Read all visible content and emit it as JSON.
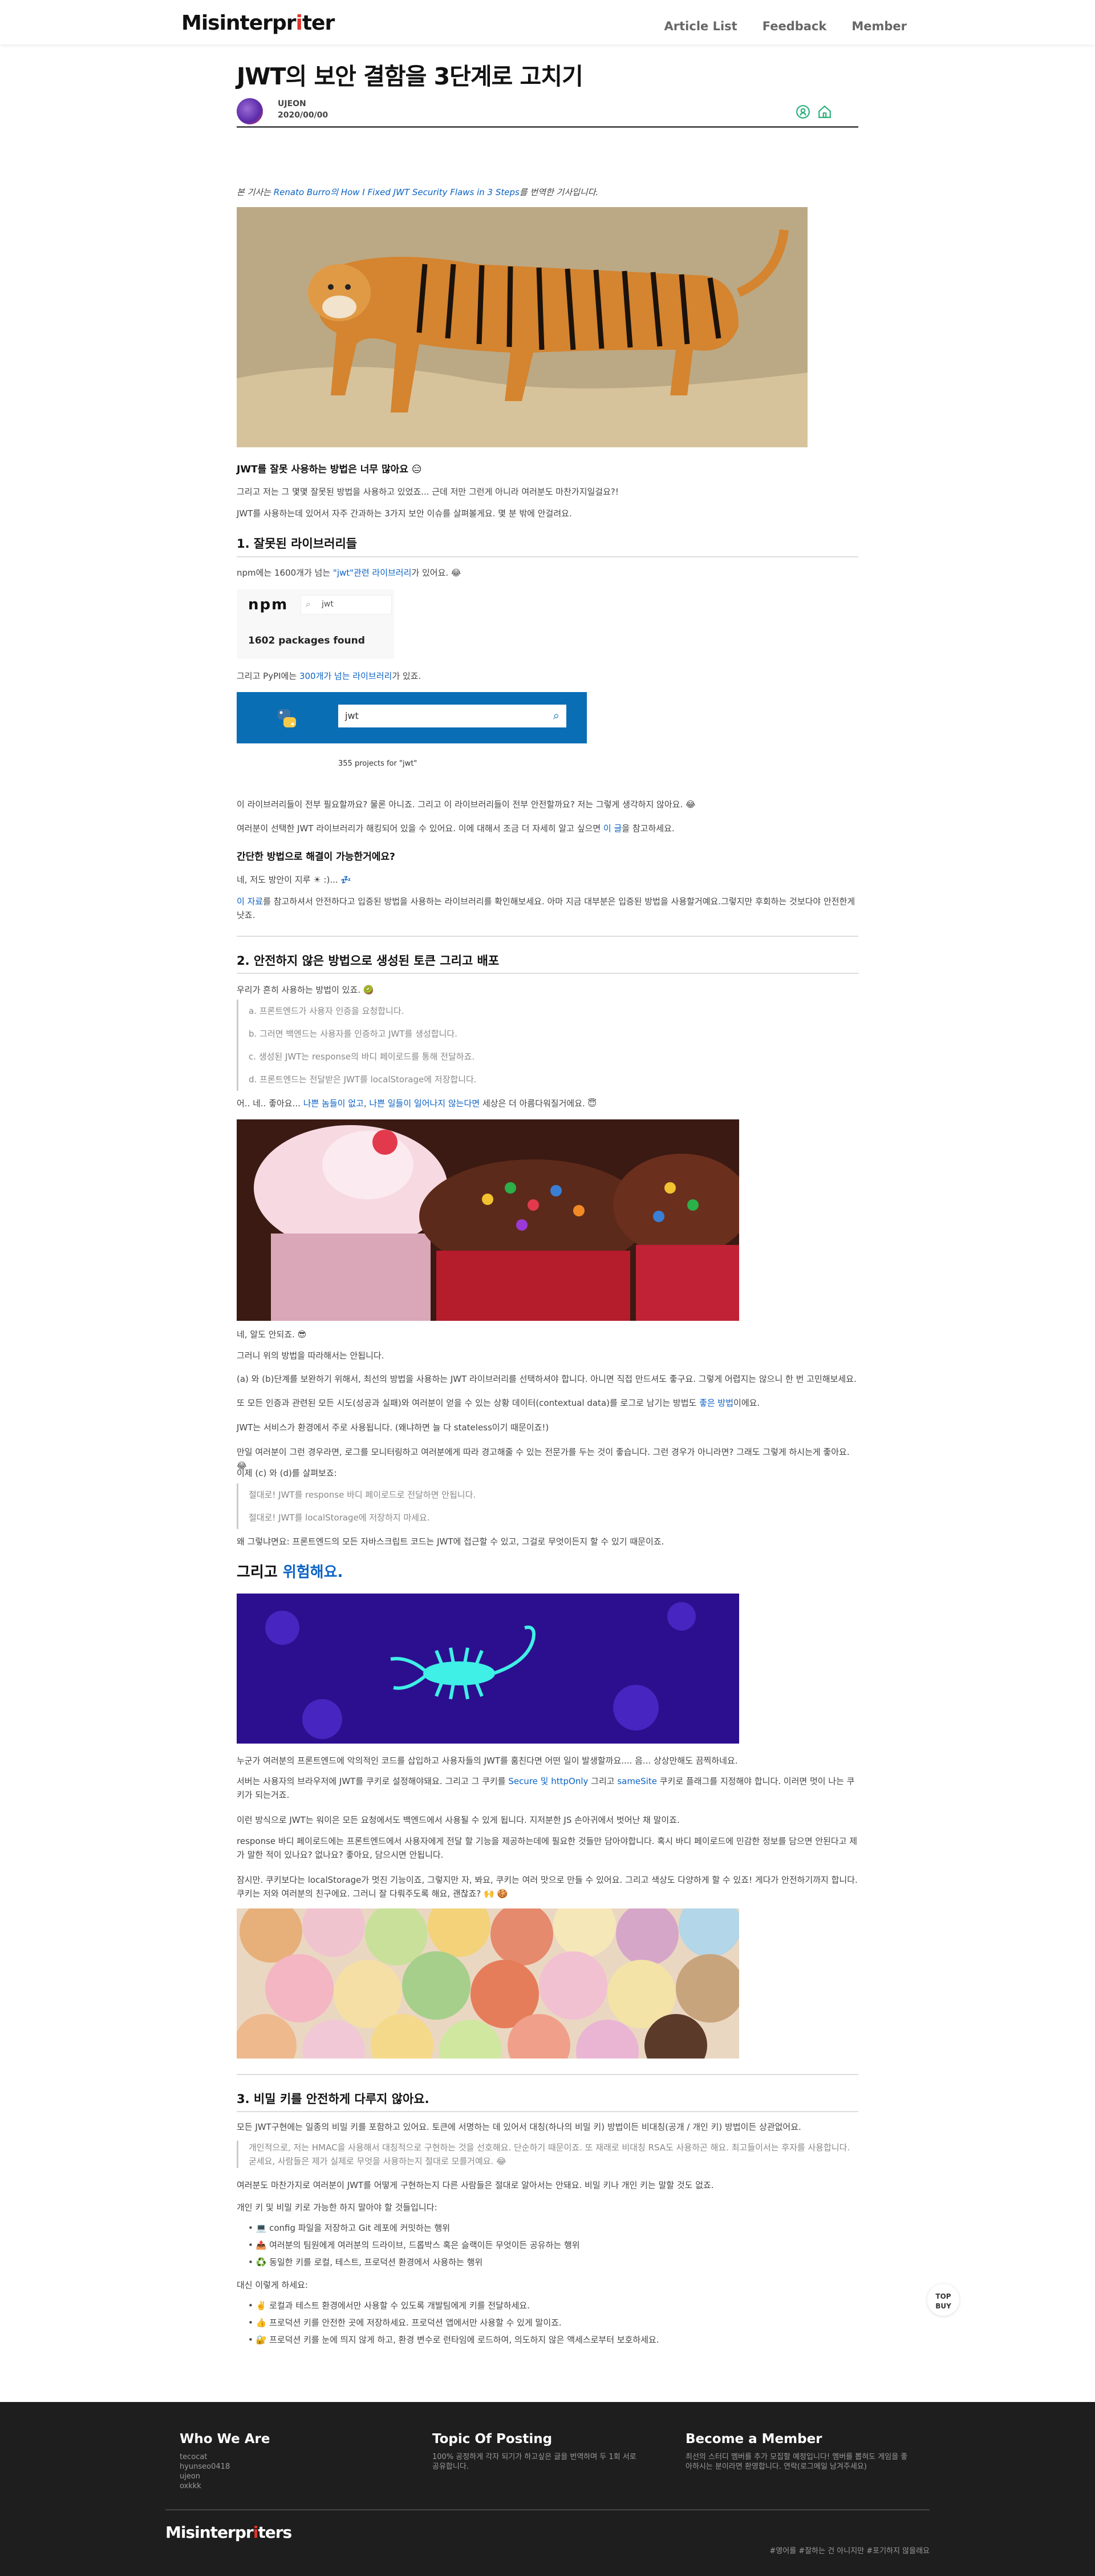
{
  "header": {
    "logo_main": "Misinterpr",
    "logo_accent": "i",
    "logo_end": "ter",
    "nav": [
      "Article List",
      "Feedback",
      "Member"
    ]
  },
  "post": {
    "title": "JWT의 보안 결함을 3단계로 고치기",
    "author": "UJEON",
    "date": "2020/00/00"
  },
  "intro": {
    "prefix": "본 기사는 ",
    "link": "Renato Burro의 How I Fixed JWT Security Flaws in 3 Steps",
    "suffix": "를 번역한 기사입니다."
  },
  "s0": {
    "heading": "JWT를 잘못 사용하는 방법은 너무 많아요 😑",
    "p1": "그리고 저는 그 몇몇 잘못된 방법을 사용하고 있었죠... 근데 저만 그런게 아니라 여러분도 마찬가지일걸요?!",
    "p2": "JWT를 사용하는데 있어서 자주 간과하는 3가지 보안 이슈를 살펴볼게요. 몇 분 밖에 안걸려요."
  },
  "s1": {
    "heading": "1. 잘못된 라이브러리들",
    "npm_prefix": "npm에는 1600개가 넘는 ",
    "npm_link": "\"jwt\"관련 라이브러리",
    "npm_suffix": "가 있어요. 😂",
    "npm_logo": "npm",
    "npm_search": "jwt",
    "npm_count": "1602 packages found",
    "pypi_prefix": "그리고 PyPI에는 ",
    "pypi_link": "300개가 넘는 라이브러리",
    "pypi_suffix": "가 있죠.",
    "pypi_search": "jwt",
    "pypi_count": "355 projects for \"jwt\"",
    "p1": "이 라이브러리들이 전부 필요할까요? 물론 아니죠. 그리고 이 라이브러리들이 전부 안전할까요? 저는 그렇게 생각하지 않아요. 😂",
    "p2_prefix": "여러분이 선택한 JWT 라이브러리가 해킹되어 있을 수 있어요. 이에 대해서 조금 더 자세히 알고 싶으면 ",
    "p2_link": "이 글",
    "p2_suffix": "을 참고하세요.",
    "sub": "간단한 방법으로 해결이 가능한거에요?",
    "p3": "네, 저도 방안이 지루 ☀ :)... 💤",
    "p4_link": "이 자료",
    "p4": "를 참고하셔서 안전하다고 입증된 방법을 사용하는 라이브러리를 확인해보세요. 아마 지금 대부분은 입증된 방법을 사용할거예요.그렇지만 후회하는 것보다야 안전한게 낫죠."
  },
  "s2": {
    "heading": "2. 안전하지 않은 방법으로 생성된 토큰 그리고 배포",
    "p0": "우리가 흔히 사용하는 방법이 있죠. 🥝",
    "list": [
      "a. 프론트엔드가 사용자 인증을 요청합니다.",
      "b. 그러면 백엔드는 사용자를 인증하고 JWT를 생성합니다.",
      "c. 생성된 JWT는 response의 바디 페이로드를 통해 전달하죠.",
      "d. 프론트엔드는 전달받은 JWT를 localStorage에 저장합니다."
    ],
    "p1_prefix": "어.. 네.. 좋아요... ",
    "p1_link1": "나쁜 놈들이 없고",
    "p1_mid": ", ",
    "p1_link2": "나쁜 일들이 일어나지 않는다면",
    "p1_suffix": " 세상은 더 아름다워질거에요. 😇",
    "p2": "네, 알도 안되죠. 😎",
    "p3": "그러니 위의 방법을 따라해서는 안됩니다.",
    "p4": "(a) 와 (b)단계를 보완하기 위해서, 최선의 방법을 사용하는 JWT 라이브러리를 선택하셔야 합니다. 아니면 직접 만드셔도 좋구요. 그렇게 어렵지는 않으니 한 번 고민해보세요.",
    "p5_prefix": "또 모든 인증과 관련된 모든 시도(성공과 실패)와 여러분이 얻을 수 있는 상황 데이터(contextual data)를 로그로 남기는 방법도 ",
    "p5_link": "좋은 방법",
    "p5_suffix": "이에요.",
    "p6": "JWT는 서비스가 환경에서 주로 사용됩니다. (왜냐하면 늘 다 stateless이기 때문이죠!)",
    "p7": "만일 여러분이 그런 경우라면, 로그를 모니터링하고 여러분에게 따라 경고해줄 수 있는 전문가를 두는 것이 좋습니다. 그런 경우가 아니라면? 그래도 그렇게 하시는게 좋아요. 😂",
    "p8": "이제 (c) 와 (d)를 살펴보죠:",
    "list2": [
      "절대로! JWT를 response 바디 페이로드로 전달하면 안됩니다.",
      "절대로! JWT를 localStorage에 저장하지 마세요."
    ],
    "p9": "왜 그렇냐면요: 프론트엔드의 모든 자바스크립트 코드는 JWT에 접근할 수 있고, 그걸로 무엇이든지 할 수 있기 때문이죠.",
    "big_prefix": "그리고 ",
    "big_link": "위험해요.",
    "p10": "누군가 여러분의 프론트엔드에 악의적인 코드를 삽입하고 사용자들의 JWT를 훔친다면 어떤 일이 발생할까요.... 음... 상상만해도 끔찍하네요.",
    "p11_prefix": "서버는 사용자의 브라우저에 JWT를 쿠키로 설정해야돼요. 그리고 그 쿠키를 ",
    "p11_link1": "Secure 및 httpOnly",
    "p11_mid": " 그리고 ",
    "p11_link2": "sameSite",
    "p11_suffix": " 쿠키로 플래그를 지정해야 합니다. 이러면 멋이 나는 쿠키가 되는거죠.",
    "p12": "이런 방식으로 JWT는 워이은 모든 요청에서도 백엔드에서 사용될 수 있게 됩니다. 지저분한 JS 손아귀에서 벗어난 채 말이죠.",
    "p13": "response 바디 페이로드에는 프론트엔드에서 사용자에게 전달 할 기능을 제공하는데에 필요한 것들만 담아야합니다. 혹시 바디 페이로드에 민감한 정보를 담으면 안된다고 제가 말한 적이 있나요? 없나요? 좋아요, 담으시면 안됩니다.",
    "p14": "잠시만. 쿠키보다는 localStorage가 멋진 기능이죠, 그렇지만 자, 봐요, 쿠키는 여러 맛으로 만들 수 있어요. 그리고 색상도 다양하게 할 수 있죠! 게다가 안전하기까지 합니다. 쿠키는 저와 여러분의 친구에요. 그러니 잘 다뤄주도록 해요, 괜찮죠? 🙌 🍪"
  },
  "s3": {
    "heading": "3. 비밀 키를 안전하게 다루지 않아요.",
    "p1": "모든 JWT구현에는 일종의 비밀 키를 포함하고 있어요. 토큰에 서명하는 데 있어서 대칭(하나의 비밀 키) 방법이든 비대칭(공개 / 개인 키) 방법이든 상관없어요.",
    "quote": "개인적으로, 저는 HMAC을 사용해서 대칭적으로 구현하는 것을 선호해요. 단순하기 때문이죠. 또 재래로 비대칭 RSA도 사용하곤 해요. 최고들이서는 후자를 사용합니다. 굳세요, 사람들은 제가 실제로 무엇을 사용하는지 절대로 모를거예요. 😂",
    "p2": "여러분도 마찬가지로 여러분이 JWT를 어떻게 구현하는지 다른 사람들은 절대로 알아서는 안돼요. 비밀 키나 개인 키는 말할 것도 없죠.",
    "p3": "개인 키 및 비밀 키로 가능한 하지 말아야 할 것들입니다:",
    "bad": [
      "💻 config 파일을 저장하고 Git 레포에 커밋하는 행위",
      "📤 여러분의 팀원에게 여러분의 드라이브, 드롭박스 혹은 슬랙이든 무엇이든 공유하는 행위",
      "♻️ 동일한 키를 로컬, 테스트, 프로덕션 환경에서 사용하는 행위"
    ],
    "p4": "대신 이렇게 하세요:",
    "good": [
      "✌️ 로컬과 테스트 환경에서만 사용할 수 있도록 개발팀에게 키를 전달하세요.",
      "👍 프로덕션 키를 안전한 곳에 저장하세요. 프로덕션 앱에서만 사용할 수 있게 말이죠.",
      "🔐 프로덕션 키를 눈에 띄지 않게 하고, 환경 변수로 런타임에 로드하여, 의도하지 않은 액세스로부터 보호하세요."
    ]
  },
  "floating": {
    "top": "TOP",
    "buy": "BUY"
  },
  "footer": {
    "col1_title": "Who We Are",
    "col1_lines": [
      "tecocat",
      "hyunseo0418",
      "ujeon",
      "oxkkk"
    ],
    "col2_title": "Topic Of Posting",
    "col2_text": "100% 공정하게 각자 되기가 하고싶은 글을 번역하며 두 1회 서로 공유합니다.",
    "col3_title": "Become a Member",
    "col3_text": "최선의 스터디 멤버를 추가 모집할 예정입니다! 멤버를 뽑혀도 게임을 좋아하시는 분이라면 환영합니다. 연락(로그메일 남겨주세요)",
    "logo_main": "Misinterpr",
    "logo_accent": "i",
    "logo_end": "ters",
    "tags": "#영어를 #잘하는 건 아니지만 #포기하지 않을래요"
  }
}
